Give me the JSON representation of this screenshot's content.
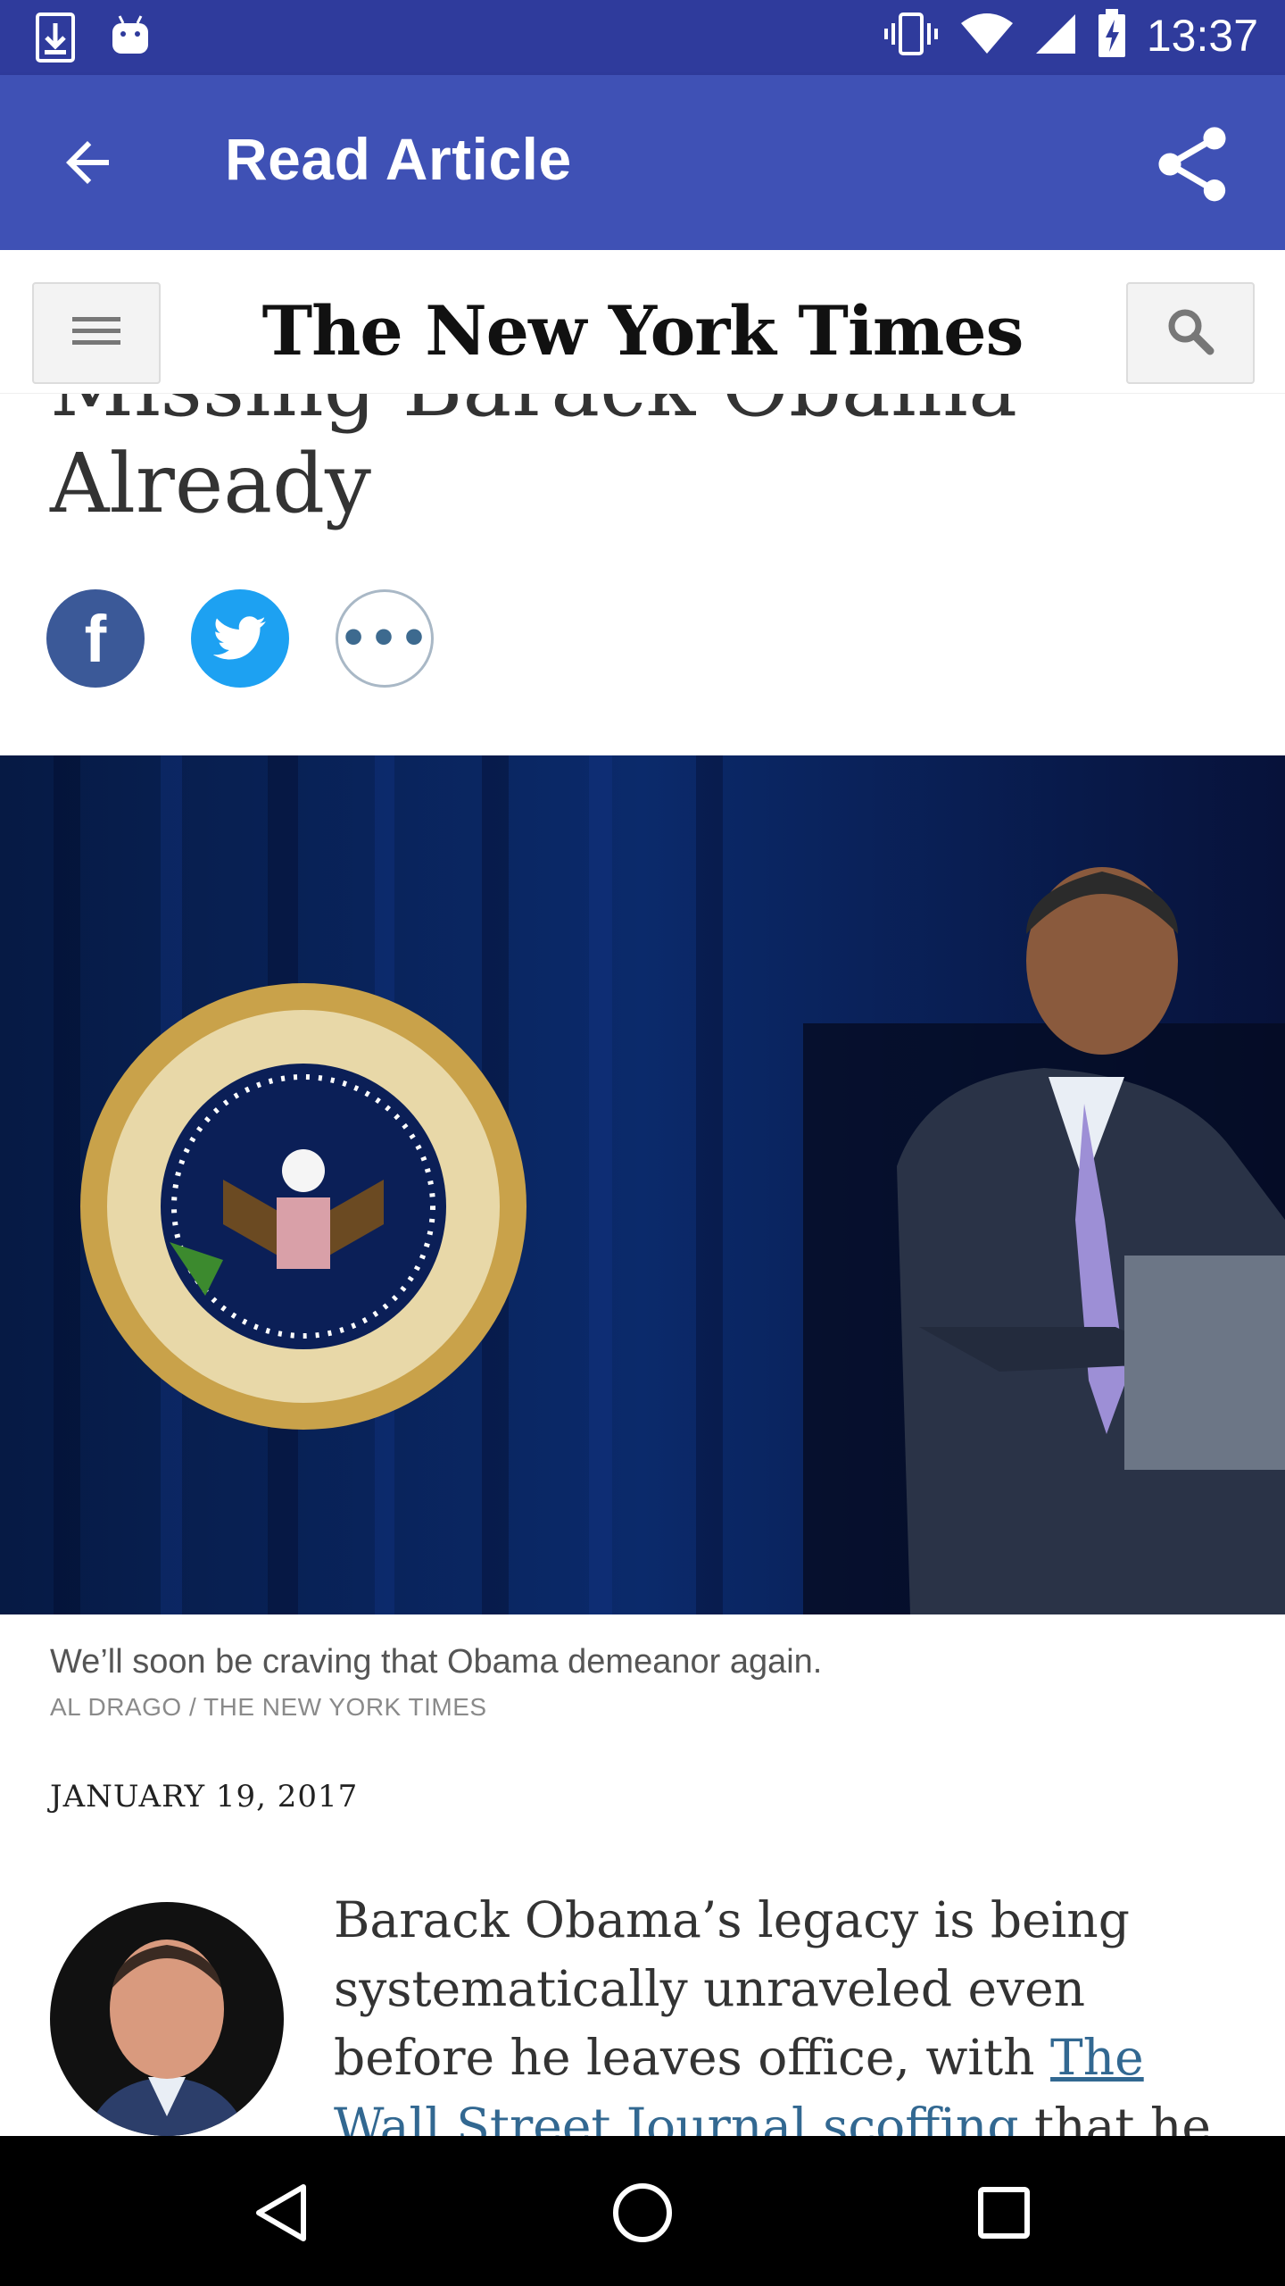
{
  "status_bar": {
    "time": "13:37",
    "left_icons": [
      "download-icon",
      "android-icon"
    ],
    "right_icons": [
      "vibrate-icon",
      "wifi-icon",
      "cell-signal-icon",
      "battery-charging-icon"
    ]
  },
  "app_bar": {
    "title": "Read Article",
    "back_icon": "arrow-back-icon",
    "share_icon": "share-icon",
    "color": "#3f51b5"
  },
  "nyt_header": {
    "logo_text": "The New York Times",
    "menu_icon": "menu-icon",
    "search_icon": "search-icon"
  },
  "article": {
    "headline_partial": "Missing Barack Obama",
    "headline_last": "Already",
    "share_buttons": [
      {
        "name": "facebook-icon",
        "label": "f",
        "color": "#3b5998"
      },
      {
        "name": "twitter-icon",
        "color": "#1da1f2"
      },
      {
        "name": "more-icon",
        "label": "•••"
      }
    ],
    "caption": "We’ll soon be craving that Obama demeanor again.",
    "credit": "AL DRAGO / THE NEW YORK TIMES",
    "date": "JANUARY 19, 2017",
    "body_intro": "Barack Obama’s legacy is being systematically unraveled even before he leaves office, with ",
    "body_link": "The Wall Street Journal scoffing",
    "body_after_link": " that he “has been a",
    "link_color": "#326891"
  },
  "nav_bar": {
    "buttons": [
      "nav-back-icon",
      "nav-home-icon",
      "nav-recents-icon"
    ]
  }
}
